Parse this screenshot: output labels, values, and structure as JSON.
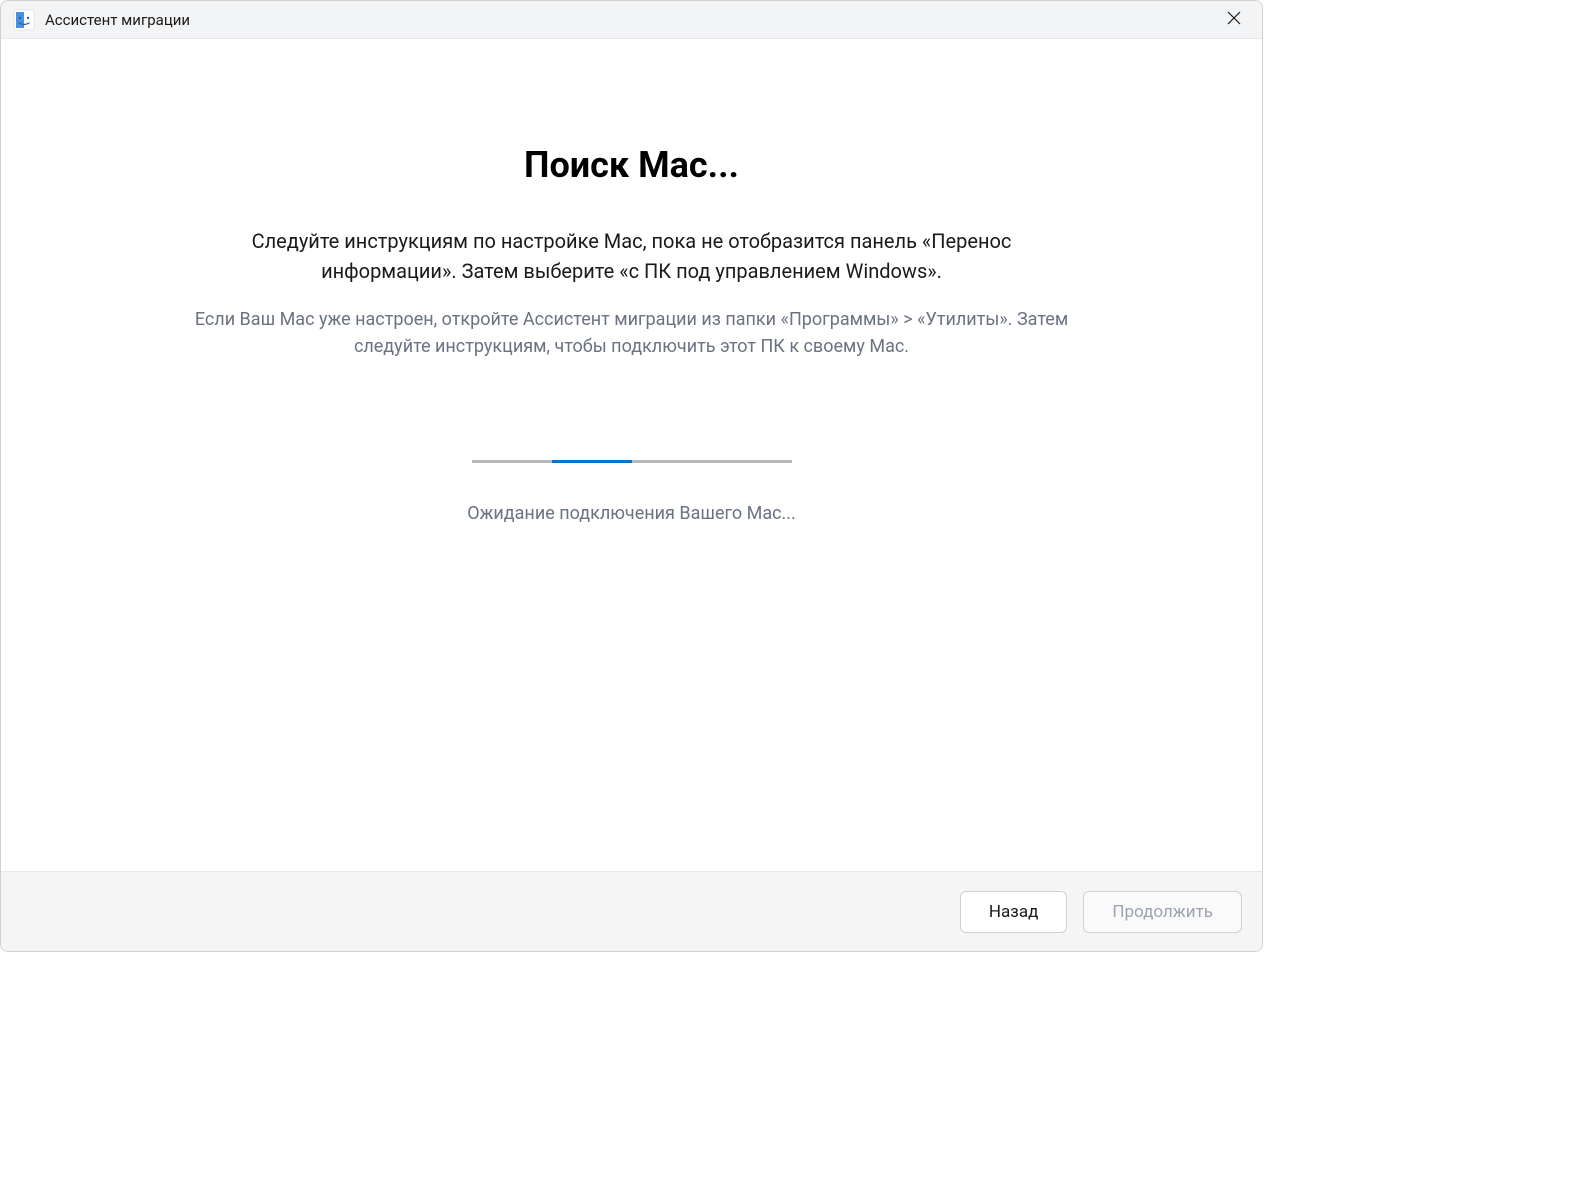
{
  "titlebar": {
    "app_title": "Ассистент миграции"
  },
  "content": {
    "heading": "Поиск Mac...",
    "instruction": "Следуйте инструкциям по настройке Mac, пока не отобразится панель «Перенос информации». Затем выберите «с ПК под управлением Windows».",
    "subinstruction": "Если Ваш Mac уже настроен, откройте Ассистент миграции из папки «Программы» > «Утилиты». Затем следуйте инструкциям, чтобы подключить этот ПК к своему Mac.",
    "status_text": "Ожидание подключения Вашего Mac..."
  },
  "footer": {
    "back_label": "Назад",
    "continue_label": "Продолжить"
  }
}
